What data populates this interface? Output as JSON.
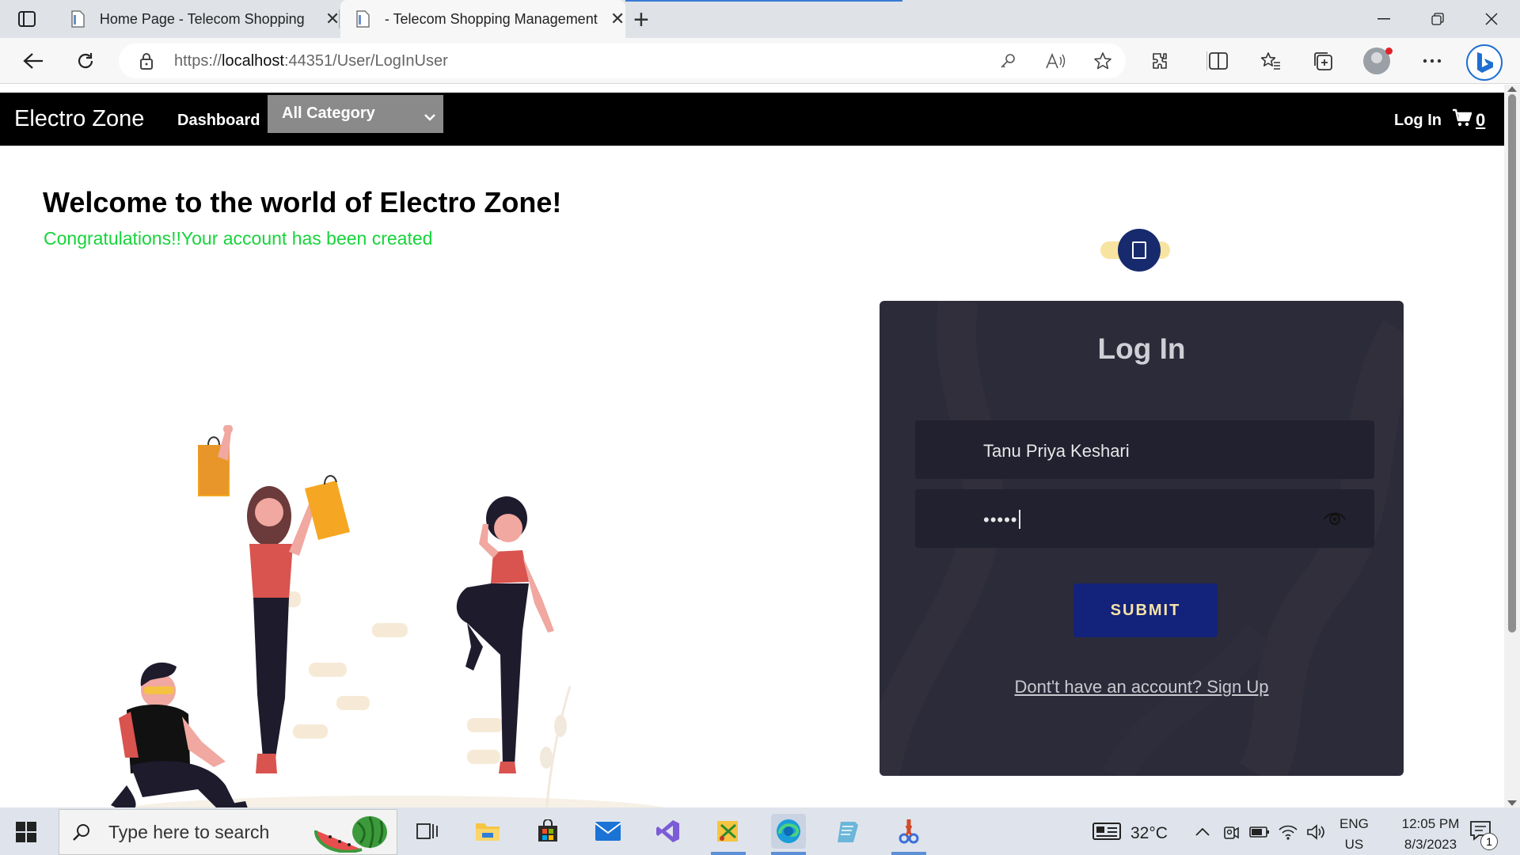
{
  "browser": {
    "tabs": [
      {
        "title": "Home Page - Telecom Shopping"
      },
      {
        "title": "- Telecom Shopping Management"
      }
    ],
    "url_prefix": "https://",
    "url_host": "localhost",
    "url_rest": ":44351/User/LogInUser"
  },
  "site": {
    "brand": "Electro Zone",
    "nav_dashboard": "Dashboard",
    "category_selected": "All Category",
    "nav_login": "Log In",
    "cart_count": "0"
  },
  "page": {
    "welcome": "Welcome to the world of Electro Zone!",
    "congrats": "Congratulations!!Your account has been created"
  },
  "login": {
    "title": "Log In",
    "username_value": "Tanu Priya Keshari",
    "password_mask": "•••••",
    "submit_label": "SUBMIT",
    "signup_link": "Dont't have an account? Sign Up"
  },
  "taskbar": {
    "search_placeholder": "Type here to search",
    "temperature": "32°C",
    "language": "ENG",
    "region": "US",
    "time": "12:05 PM",
    "date": "8/3/2023",
    "notification_count": "1"
  },
  "colors": {
    "navbar": "#000000",
    "congrats": "#17d43a",
    "card": "#2c2b3a",
    "submit": "#13227a",
    "submit_text": "#f7e3a5",
    "toggle_knob": "#172a6d",
    "toggle_track": "#f7e4a0"
  },
  "icons": [
    "tab-actions-icon",
    "back-icon",
    "refresh-icon",
    "lock-icon",
    "key-icon",
    "read-aloud-icon",
    "favorite-star-icon",
    "extensions-icon",
    "split-screen-icon",
    "favorites-icon",
    "collections-icon",
    "more-icon",
    "bing-icon",
    "cart-icon",
    "eye-icon",
    "windows-start-icon",
    "search-icon"
  ]
}
